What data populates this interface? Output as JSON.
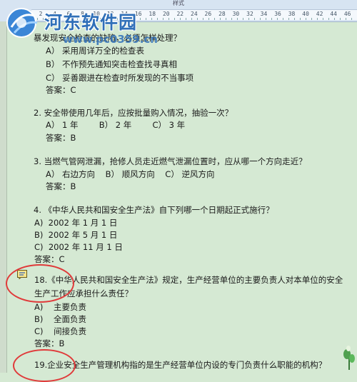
{
  "window": {
    "title": "样式"
  },
  "ruler": {
    "marks": [
      "2",
      "4",
      "6",
      "8",
      "10",
      "12",
      "14",
      "16",
      "18",
      "20",
      "22",
      "24",
      "26",
      "28",
      "30",
      "32",
      "34",
      "36",
      "38",
      "40",
      "42",
      "44",
      "46"
    ]
  },
  "watermark": {
    "site_name": "河东软件园",
    "url": "www.pc0359.cn"
  },
  "document": {
    "q1": {
      "text": "暴发现安全检查的缺陷，必须怎样处理？",
      "a": "A） 采用周详万全的检查表",
      "b": "B） 不作预先通知突击检查找寻真相",
      "c": "C） 妥善跟进在检查时所发现的不当事项",
      "answer": "答案：C"
    },
    "q2": {
      "text": "2.  安全带使用几年后，应按批量购入情况，抽验一次？",
      "opts": "A） 1 年        B） 2 年        C） 3 年",
      "answer": "答案：B"
    },
    "q3": {
      "text": "3.  当燃气管网泄漏，抢修人员走近燃气泄漏位置时，应从哪一个方向走近？",
      "opts": "A） 右边方向    B） 顺风方向    C） 逆风方向",
      "answer": "答案：B"
    },
    "q4": {
      "text": "4.  《中华人民共和国安全生产法》自下列哪一个日期起正式施行？",
      "a": "A)  2002 年 1 月 1 日",
      "b": "B)  2002 年 5 月 1 日",
      "c": "C)  2002 年 11 月 1 日",
      "answer": "答案：C"
    },
    "q18": {
      "line1": "18.《中华人民共和国安全生产法》规定，生产经营单位的主要负责人对本单位的安全",
      "line2": "生产工作应承担什么责任？",
      "a": "A)    主要负责",
      "b": "B)    全面负责",
      "c": "C)    间接负责",
      "answer": "答案：B"
    },
    "q19": {
      "text": "19.企业安全生产管理机构指的是生产经营单位内设的专门负责什么职能的机构？"
    }
  },
  "colors": {
    "page_bg": "#d5e9d3",
    "annotation_circle": "#e03a3a",
    "watermark": "#2f6fb8"
  }
}
